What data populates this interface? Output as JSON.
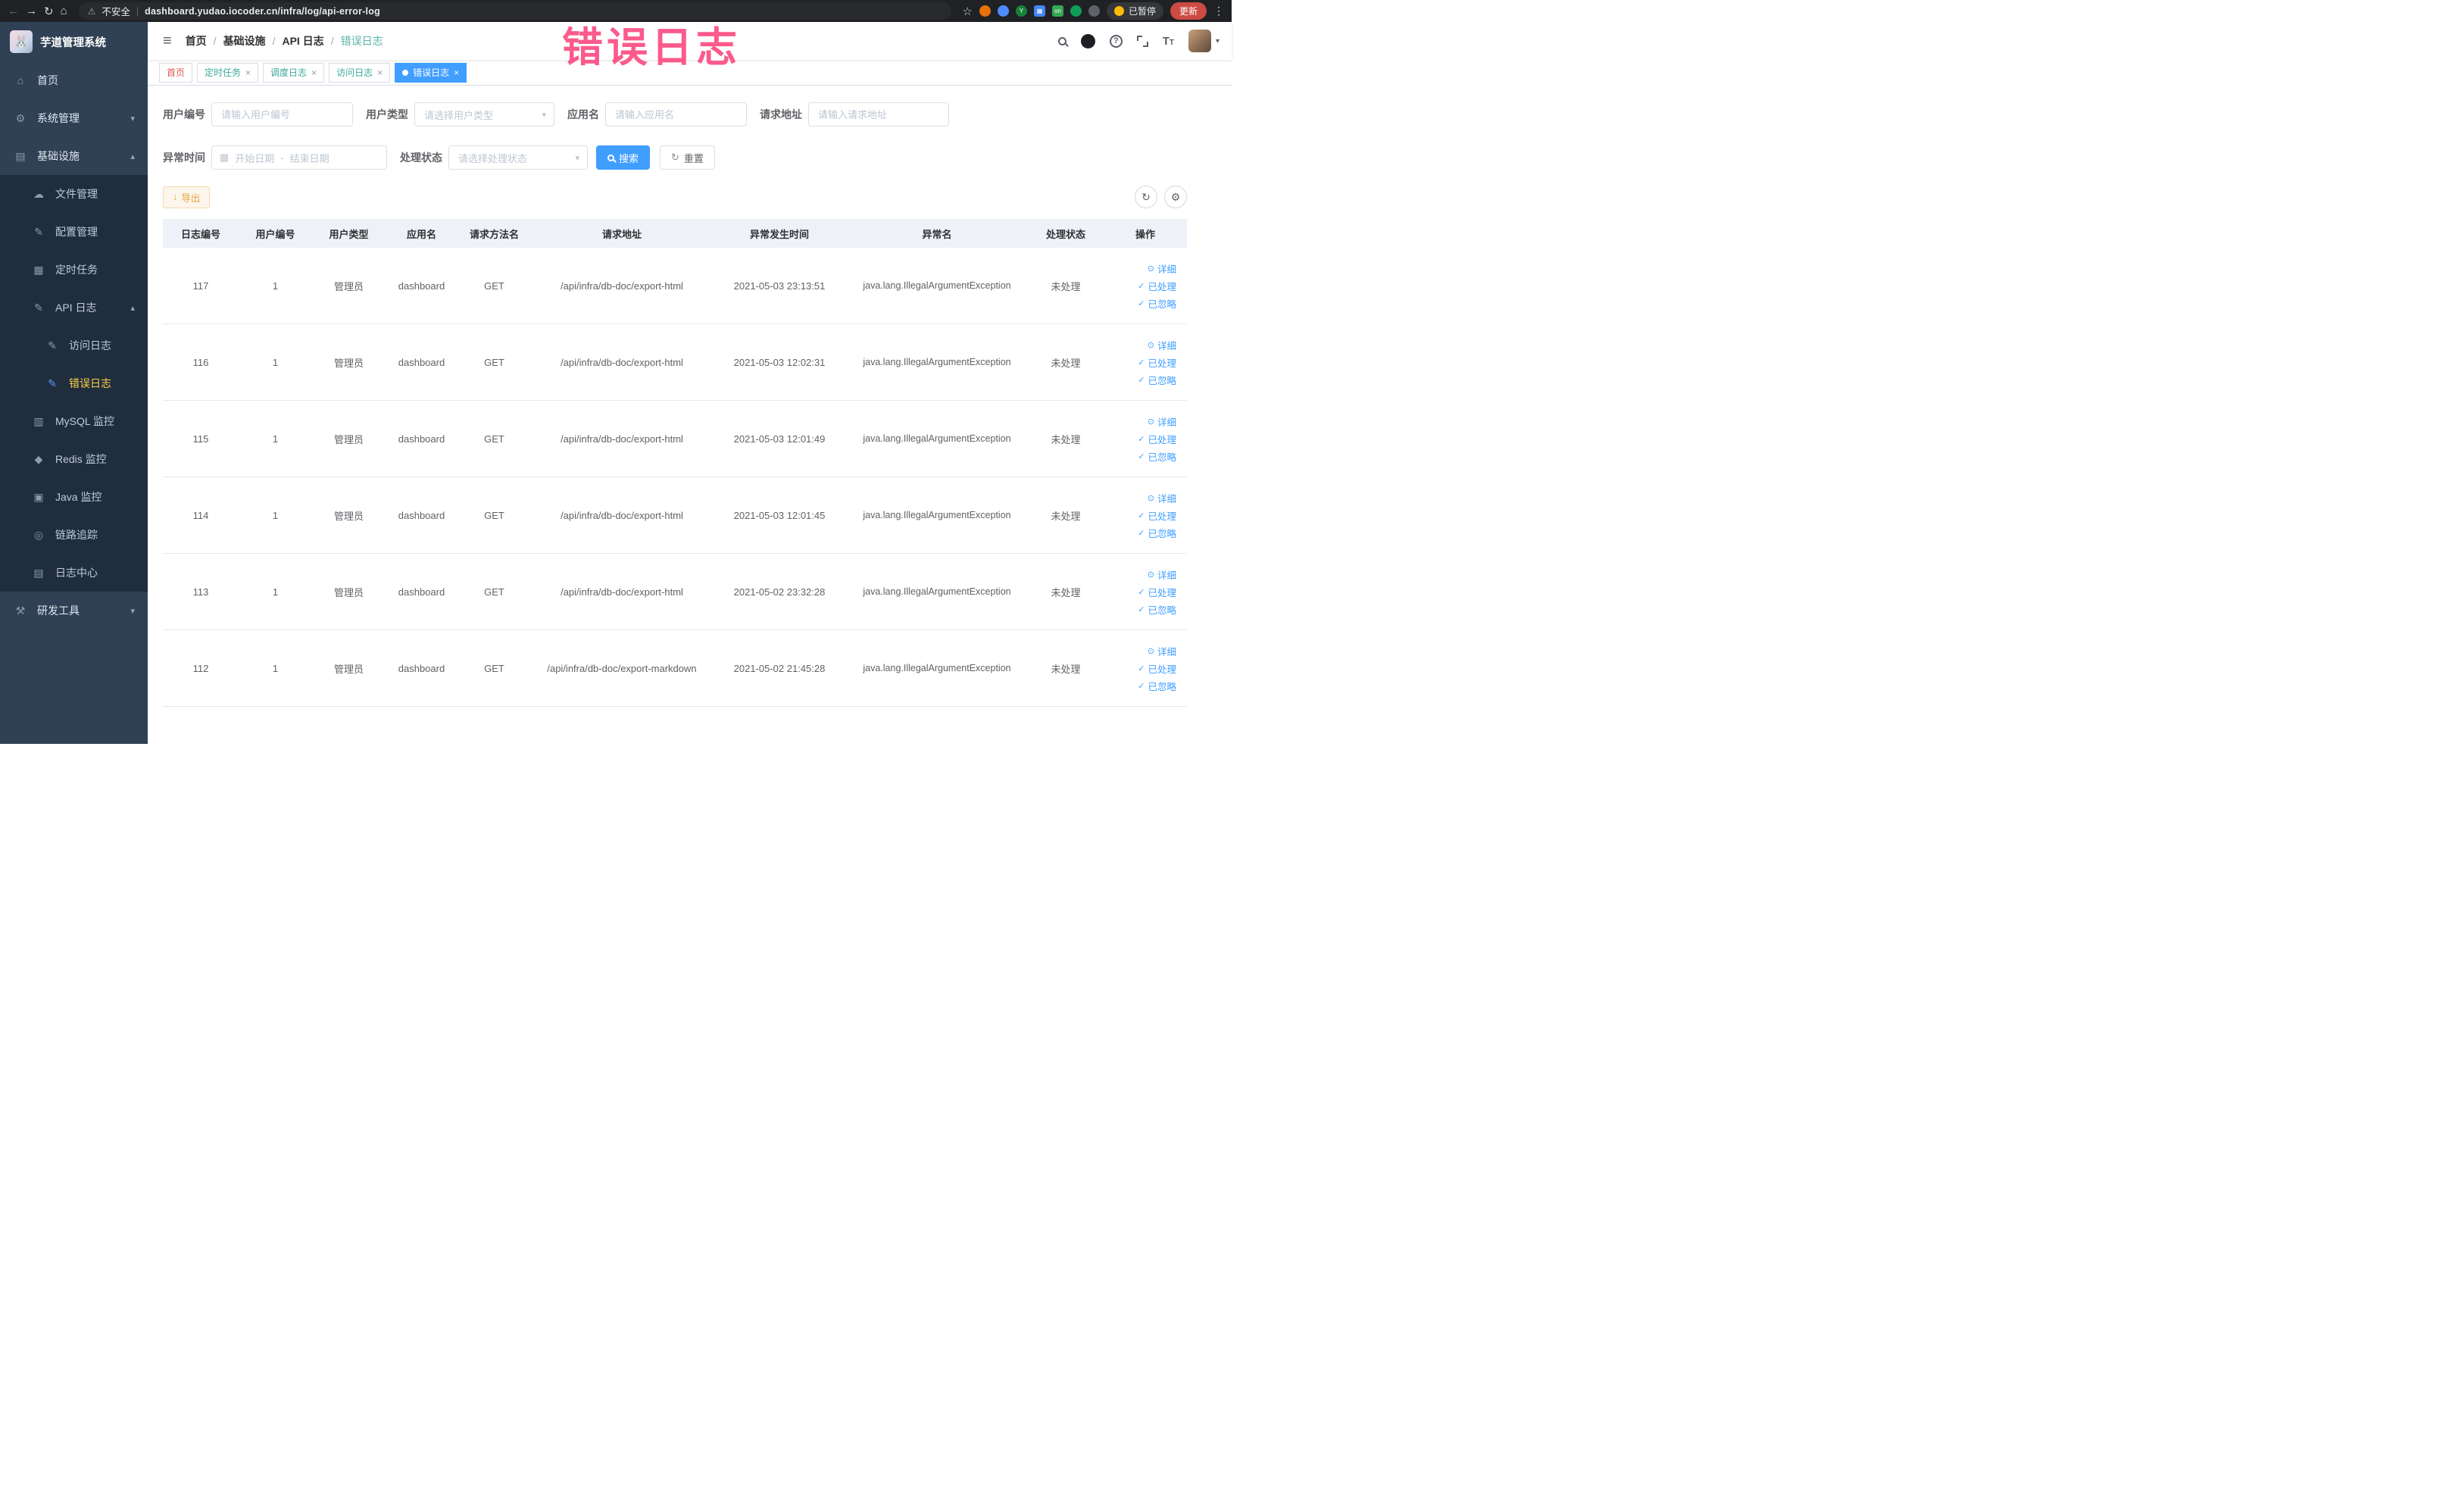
{
  "browser": {
    "security_label": "不安全",
    "url": "dashboard.yudao.iocoder.cn/infra/log/api-error-log",
    "ext_on_badge": "on",
    "ext_y_badge": "Y",
    "paused_badge": "已暂停",
    "update_button": "更新"
  },
  "watermark": "错误日志",
  "sidebar": {
    "logo_title": "芋道管理系统",
    "items": [
      {
        "label": "首页",
        "icon": "home-icon",
        "glyph": "⌂",
        "level": 1
      },
      {
        "label": "系统管理",
        "icon": "system-icon",
        "glyph": "⚙",
        "level": 1,
        "arrow": "down"
      },
      {
        "label": "基础设施",
        "icon": "infra-icon",
        "glyph": "▤",
        "level": 1,
        "arrow": "up"
      },
      {
        "label": "文件管理",
        "icon": "file-icon",
        "glyph": "☁",
        "level": 2
      },
      {
        "label": "配置管理",
        "icon": "config-icon",
        "glyph": "✎",
        "level": 2
      },
      {
        "label": "定时任务",
        "icon": "job-icon",
        "glyph": "▦",
        "level": 2
      },
      {
        "label": "API 日志",
        "icon": "api-log-icon",
        "glyph": "✎",
        "level": 2,
        "arrow": "up"
      },
      {
        "label": "访问日志",
        "icon": "access-log-icon",
        "glyph": "✎",
        "level": 3
      },
      {
        "label": "错误日志",
        "icon": "error-log-icon",
        "glyph": "✎",
        "level": 3,
        "active": true
      },
      {
        "label": "MySQL 监控",
        "icon": "mysql-icon",
        "glyph": "▥",
        "level": 2
      },
      {
        "label": "Redis 监控",
        "icon": "redis-icon",
        "glyph": "◆",
        "level": 2
      },
      {
        "label": "Java 监控",
        "icon": "java-icon",
        "glyph": "▣",
        "level": 2
      },
      {
        "label": "链路追踪",
        "icon": "trace-icon",
        "glyph": "◎",
        "level": 2
      },
      {
        "label": "日志中心",
        "icon": "log-center-icon",
        "glyph": "▤",
        "level": 2
      },
      {
        "label": "研发工具",
        "icon": "devtools-icon",
        "glyph": "⚒",
        "level": 1,
        "arrow": "down"
      }
    ]
  },
  "header": {
    "breadcrumb": [
      "首页",
      "基础设施",
      "API 日志",
      "错误日志"
    ]
  },
  "tags": [
    {
      "label": "首页",
      "style": "home",
      "closable": false,
      "active": false
    },
    {
      "label": "定时任务",
      "style": "teal",
      "closable": true,
      "active": false
    },
    {
      "label": "调度日志",
      "style": "teal",
      "closable": true,
      "active": false
    },
    {
      "label": "访问日志",
      "style": "teal",
      "closable": true,
      "active": false
    },
    {
      "label": "错误日志",
      "style": "active",
      "closable": true,
      "active": true
    }
  ],
  "filters": {
    "user_id": {
      "label": "用户编号",
      "placeholder": "请输入用户编号"
    },
    "user_type": {
      "label": "用户类型",
      "placeholder": "请选择用户类型"
    },
    "app_name": {
      "label": "应用名",
      "placeholder": "请输入应用名"
    },
    "request_url": {
      "label": "请求地址",
      "placeholder": "请输入请求地址"
    },
    "exception_time": {
      "label": "异常时间",
      "start_placeholder": "开始日期",
      "separator": "-",
      "end_placeholder": "结束日期"
    },
    "process_status": {
      "label": "处理状态",
      "placeholder": "请选择处理状态"
    }
  },
  "actions": {
    "search": "搜索",
    "reset": "重置",
    "export": "导出"
  },
  "table": {
    "headers": [
      "日志编号",
      "用户编号",
      "用户类型",
      "应用名",
      "请求方法名",
      "请求地址",
      "异常发生时间",
      "异常名",
      "处理状态",
      "操作"
    ],
    "row_actions": [
      "详细",
      "已处理",
      "已忽略"
    ],
    "rows": [
      {
        "id": "117",
        "user_id": "1",
        "user_type": "管理员",
        "app": "dashboard",
        "method": "GET",
        "url": "/api/infra/db-doc/export-html",
        "time": "2021-05-03 23:13:51",
        "exception": "java.lang.IllegalArgumentException",
        "status": "未处理"
      },
      {
        "id": "116",
        "user_id": "1",
        "user_type": "管理员",
        "app": "dashboard",
        "method": "GET",
        "url": "/api/infra/db-doc/export-html",
        "time": "2021-05-03 12:02:31",
        "exception": "java.lang.IllegalArgumentException",
        "status": "未处理"
      },
      {
        "id": "115",
        "user_id": "1",
        "user_type": "管理员",
        "app": "dashboard",
        "method": "GET",
        "url": "/api/infra/db-doc/export-html",
        "time": "2021-05-03 12:01:49",
        "exception": "java.lang.IllegalArgumentException",
        "status": "未处理"
      },
      {
        "id": "114",
        "user_id": "1",
        "user_type": "管理员",
        "app": "dashboard",
        "method": "GET",
        "url": "/api/infra/db-doc/export-html",
        "time": "2021-05-03 12:01:45",
        "exception": "java.lang.IllegalArgumentException",
        "status": "未处理"
      },
      {
        "id": "113",
        "user_id": "1",
        "user_type": "管理员",
        "app": "dashboard",
        "method": "GET",
        "url": "/api/infra/db-doc/export-html",
        "time": "2021-05-02 23:32:28",
        "exception": "java.lang.IllegalArgumentException",
        "status": "未处理"
      },
      {
        "id": "112",
        "user_id": "1",
        "user_type": "管理员",
        "app": "dashboard",
        "method": "GET",
        "url": "/api/infra/db-doc/export-markdown",
        "time": "2021-05-02 21:45:28",
        "exception": "java.lang.IllegalArgumentException",
        "status": "未处理"
      }
    ]
  }
}
